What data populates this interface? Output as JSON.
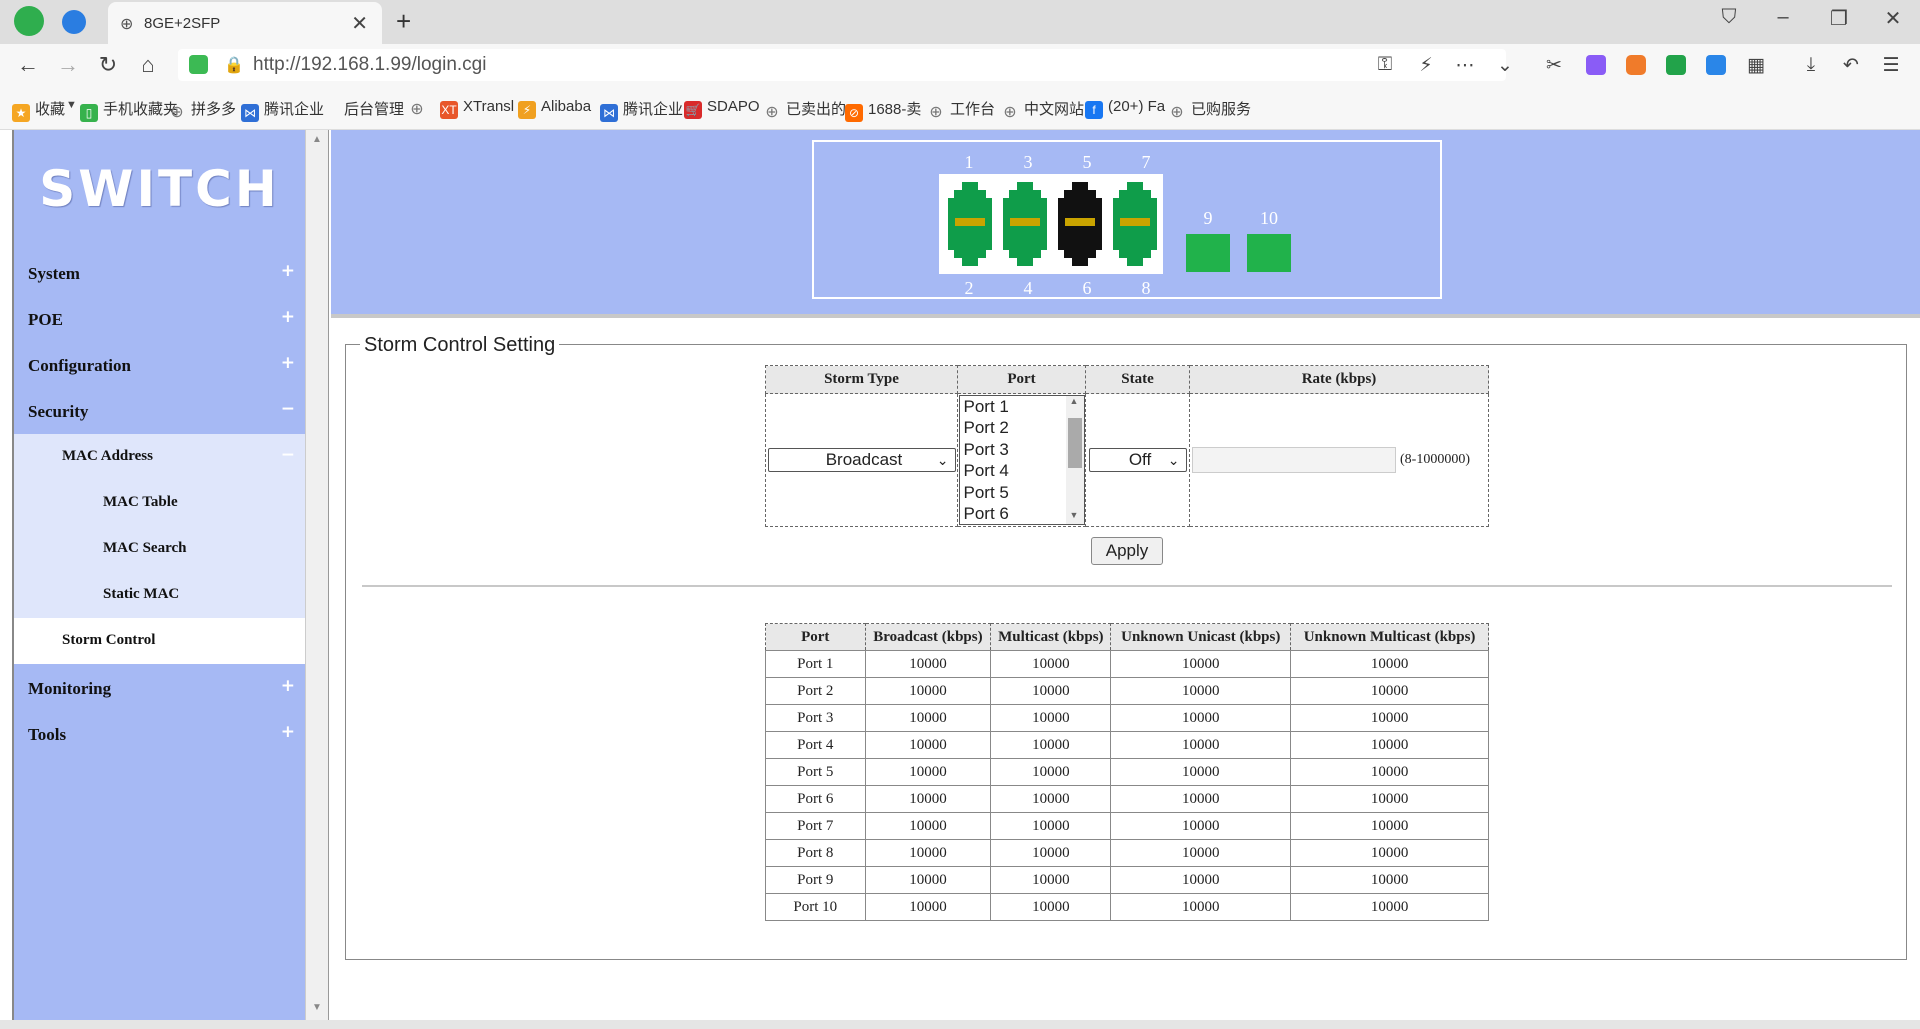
{
  "browser": {
    "tab_title": "8GE+2SFP",
    "tab_close": "✕",
    "new_tab": "+",
    "url": "http://192.168.1.99/login.cgi",
    "bookmarks": [
      {
        "label": "收藏",
        "color": "#f5a623",
        "glyph": "★"
      },
      {
        "label": "手机收藏夹",
        "color": "#37b24d",
        "glyph": "▯"
      },
      {
        "label": "拼多多",
        "color": "#888888",
        "glyph": "⊕"
      },
      {
        "label": "腾讯企业",
        "color": "#2f6fd6",
        "glyph": "⋈"
      },
      {
        "label": "后台管理",
        "color": "",
        "glyph": ""
      },
      {
        "label": "",
        "color": "#888888",
        "glyph": "⊕"
      },
      {
        "label": "XTransl",
        "color": "#e8562a",
        "glyph": "XT"
      },
      {
        "label": "Alibaba",
        "color": "#f0a020",
        "glyph": "⚡"
      },
      {
        "label": "腾讯企业",
        "color": "#2f6fd6",
        "glyph": "⋈"
      },
      {
        "label": "SDAPO",
        "color": "#d92b2b",
        "glyph": "🛒"
      },
      {
        "label": "已卖出的",
        "color": "#888888",
        "glyph": "⊕"
      },
      {
        "label": "1688-卖",
        "color": "#ff6a00",
        "glyph": "⊘"
      },
      {
        "label": "工作台",
        "color": "#888888",
        "glyph": "⊕"
      },
      {
        "label": "中文网站",
        "color": "#888888",
        "glyph": "⊕"
      },
      {
        "label": "(20+) Fa",
        "color": "#1877f2",
        "glyph": "f"
      },
      {
        "label": "已购服务",
        "color": "#888888",
        "glyph": "⊕"
      }
    ]
  },
  "sidebar": {
    "brand": "SWITCH",
    "menu": [
      {
        "label": "System",
        "sign": "+"
      },
      {
        "label": "POE",
        "sign": "+"
      },
      {
        "label": "Configuration",
        "sign": "+"
      },
      {
        "label": "Security",
        "sign": "−"
      },
      {
        "label": "MAC Address",
        "sign": "−"
      },
      {
        "label": "MAC Table",
        "sign": ""
      },
      {
        "label": "MAC Search",
        "sign": ""
      },
      {
        "label": "Static MAC",
        "sign": ""
      },
      {
        "label": "Storm Control",
        "sign": ""
      },
      {
        "label": "Monitoring",
        "sign": "+"
      },
      {
        "label": "Tools",
        "sign": "+"
      }
    ]
  },
  "ports": {
    "top_numbers": [
      "1",
      "3",
      "5",
      "7"
    ],
    "bottom_numbers": [
      "2",
      "4",
      "6",
      "8"
    ],
    "sfp_numbers": [
      "9",
      "10"
    ],
    "rj45_colors": [
      "#0f9d4a",
      "#0f9d4a",
      "#111111",
      "#0f9d4a"
    ],
    "sfp_color": "#21b24b"
  },
  "storm": {
    "legend": "Storm Control Setting",
    "headers": [
      "Storm Type",
      "Port",
      "State",
      "Rate (kbps)"
    ],
    "storm_type": "Broadcast",
    "port_options": [
      "Port 1",
      "Port 2",
      "Port 3",
      "Port 4",
      "Port 5",
      "Port 6"
    ],
    "state": "Off",
    "rate_value": "",
    "rate_range": "(8-1000000)",
    "apply": "Apply"
  },
  "rates": {
    "headers": [
      "Port",
      "Broadcast (kbps)",
      "Multicast (kbps)",
      "Unknown Unicast (kbps)",
      "Unknown Multicast (kbps)"
    ],
    "rows": [
      [
        "Port 1",
        "10000",
        "10000",
        "10000",
        "10000"
      ],
      [
        "Port 2",
        "10000",
        "10000",
        "10000",
        "10000"
      ],
      [
        "Port 3",
        "10000",
        "10000",
        "10000",
        "10000"
      ],
      [
        "Port 4",
        "10000",
        "10000",
        "10000",
        "10000"
      ],
      [
        "Port 5",
        "10000",
        "10000",
        "10000",
        "10000"
      ],
      [
        "Port 6",
        "10000",
        "10000",
        "10000",
        "10000"
      ],
      [
        "Port 7",
        "10000",
        "10000",
        "10000",
        "10000"
      ],
      [
        "Port 8",
        "10000",
        "10000",
        "10000",
        "10000"
      ],
      [
        "Port 9",
        "10000",
        "10000",
        "10000",
        "10000"
      ],
      [
        "Port 10",
        "10000",
        "10000",
        "10000",
        "10000"
      ]
    ]
  }
}
